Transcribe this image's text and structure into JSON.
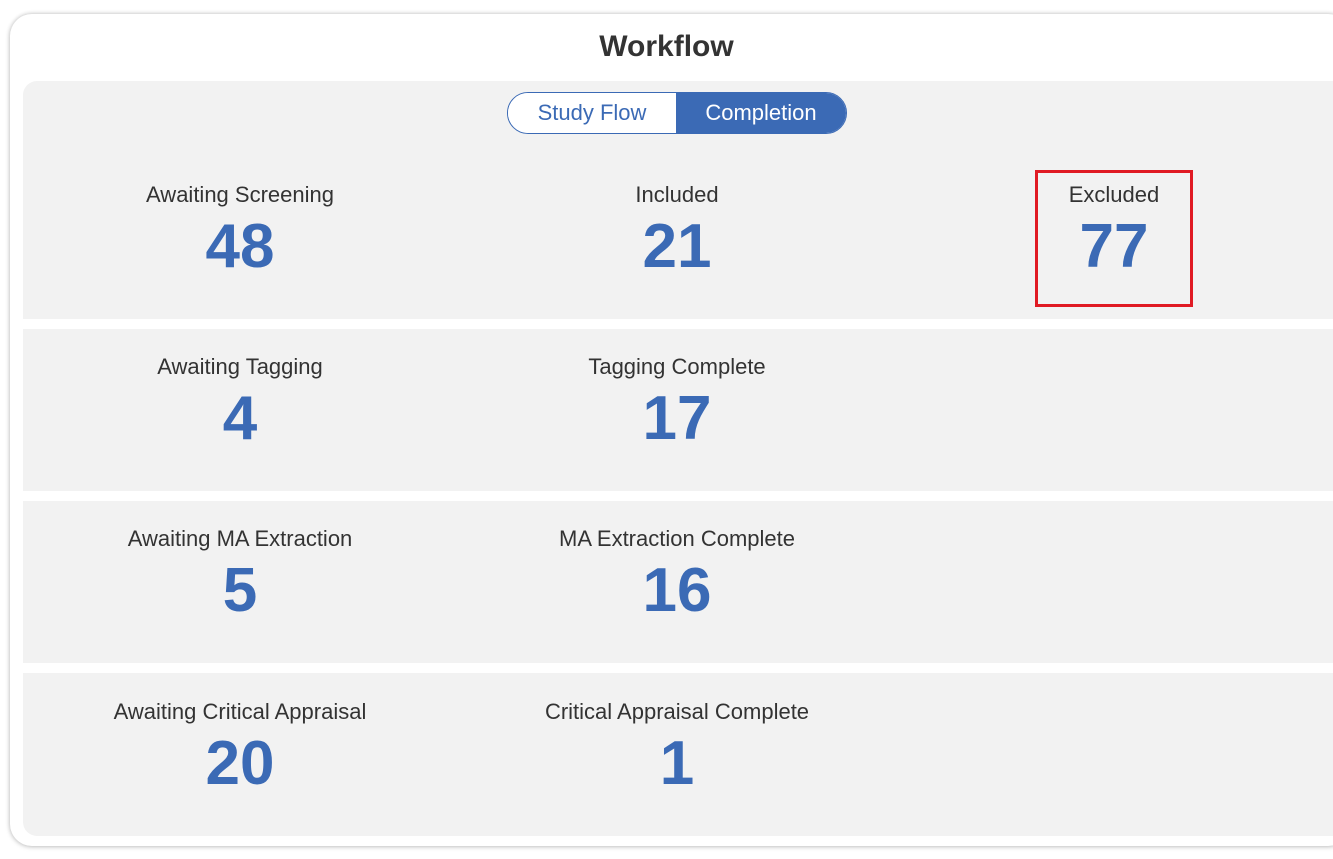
{
  "title": "Workflow",
  "toggle": {
    "options": [
      "Study Flow",
      "Completion"
    ],
    "active": "Completion"
  },
  "rows": [
    [
      {
        "label": "Awaiting Screening",
        "value": "48"
      },
      {
        "label": "Included",
        "value": "21"
      },
      {
        "label": "Excluded",
        "value": "77"
      }
    ],
    [
      {
        "label": "Awaiting Tagging",
        "value": "4"
      },
      {
        "label": "Tagging Complete",
        "value": "17"
      }
    ],
    [
      {
        "label": "Awaiting MA Extraction",
        "value": "5"
      },
      {
        "label": "MA Extraction Complete",
        "value": "16"
      }
    ],
    [
      {
        "label": "Awaiting Critical Appraisal",
        "value": "20"
      },
      {
        "label": "Critical Appraisal Complete",
        "value": "1"
      }
    ]
  ],
  "highlighted_stat": "Excluded",
  "colors": {
    "accent": "#3b6ab5",
    "panel_bg": "#f2f2f2",
    "highlight_border": "#e01b24",
    "label_text": "#333333"
  }
}
